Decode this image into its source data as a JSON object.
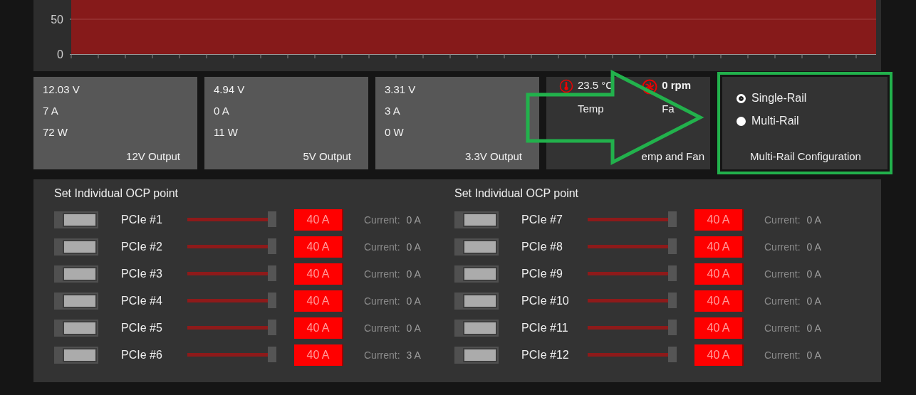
{
  "chart": {
    "y_axis_labels": [
      "50",
      "0"
    ]
  },
  "outputs": [
    {
      "voltage": "12.03 V",
      "current": "7 A",
      "power": "72 W",
      "title": "12V Output"
    },
    {
      "voltage": "4.94 V",
      "current": "0 A",
      "power": "11 W",
      "title": "5V Output"
    },
    {
      "voltage": "3.31 V",
      "current": "3 A",
      "power": "0 W",
      "title": "3.3V Output"
    }
  ],
  "temp_fan": {
    "temp_value": "23.5 °C",
    "temp_label": "Temp",
    "fan_value": "0 rpm",
    "fan_label": "Fa",
    "title": "emp and Fan"
  },
  "rail_config": {
    "options": [
      {
        "label": "Single-Rail",
        "selected": true
      },
      {
        "label": "Multi-Rail",
        "selected": false
      }
    ],
    "title": "Multi-Rail Configuration"
  },
  "ocp_groups": [
    {
      "title": "Set Individual OCP point",
      "rails": [
        {
          "name": "PCIe #1",
          "on": true,
          "level": 1,
          "limit": "40 A",
          "current_label": "Current:",
          "current": "0 A"
        },
        {
          "name": "PCIe #2",
          "on": true,
          "level": 1,
          "limit": "40 A",
          "current_label": "Current:",
          "current": "0 A"
        },
        {
          "name": "PCIe #3",
          "on": true,
          "level": 1,
          "limit": "40 A",
          "current_label": "Current:",
          "current": "0 A"
        },
        {
          "name": "PCIe #4",
          "on": true,
          "level": 1,
          "limit": "40 A",
          "current_label": "Current:",
          "current": "0 A"
        },
        {
          "name": "PCIe #5",
          "on": true,
          "level": 1,
          "limit": "40 A",
          "current_label": "Current:",
          "current": "0 A"
        },
        {
          "name": "PCIe #6",
          "on": true,
          "level": 1,
          "limit": "40 A",
          "current_label": "Current:",
          "current": "3 A"
        }
      ]
    },
    {
      "title": "Set Individual OCP point",
      "rails": [
        {
          "name": "PCIe #7",
          "on": true,
          "level": 1,
          "limit": "40 A",
          "current_label": "Current:",
          "current": "0 A"
        },
        {
          "name": "PCIe #8",
          "on": true,
          "level": 1,
          "limit": "40 A",
          "current_label": "Current:",
          "current": "0 A"
        },
        {
          "name": "PCIe #9",
          "on": true,
          "level": 1,
          "limit": "40 A",
          "current_label": "Current:",
          "current": "0 A"
        },
        {
          "name": "PCIe #10",
          "on": true,
          "level": 1,
          "limit": "40 A",
          "current_label": "Current:",
          "current": "0 A"
        },
        {
          "name": "PCIe #11",
          "on": true,
          "level": 1,
          "limit": "40 A",
          "current_label": "Current:",
          "current": "0 A"
        },
        {
          "name": "PCIe #12",
          "on": true,
          "level": 1,
          "limit": "40 A",
          "current_label": "Current:",
          "current": "0 A"
        }
      ]
    }
  ]
}
